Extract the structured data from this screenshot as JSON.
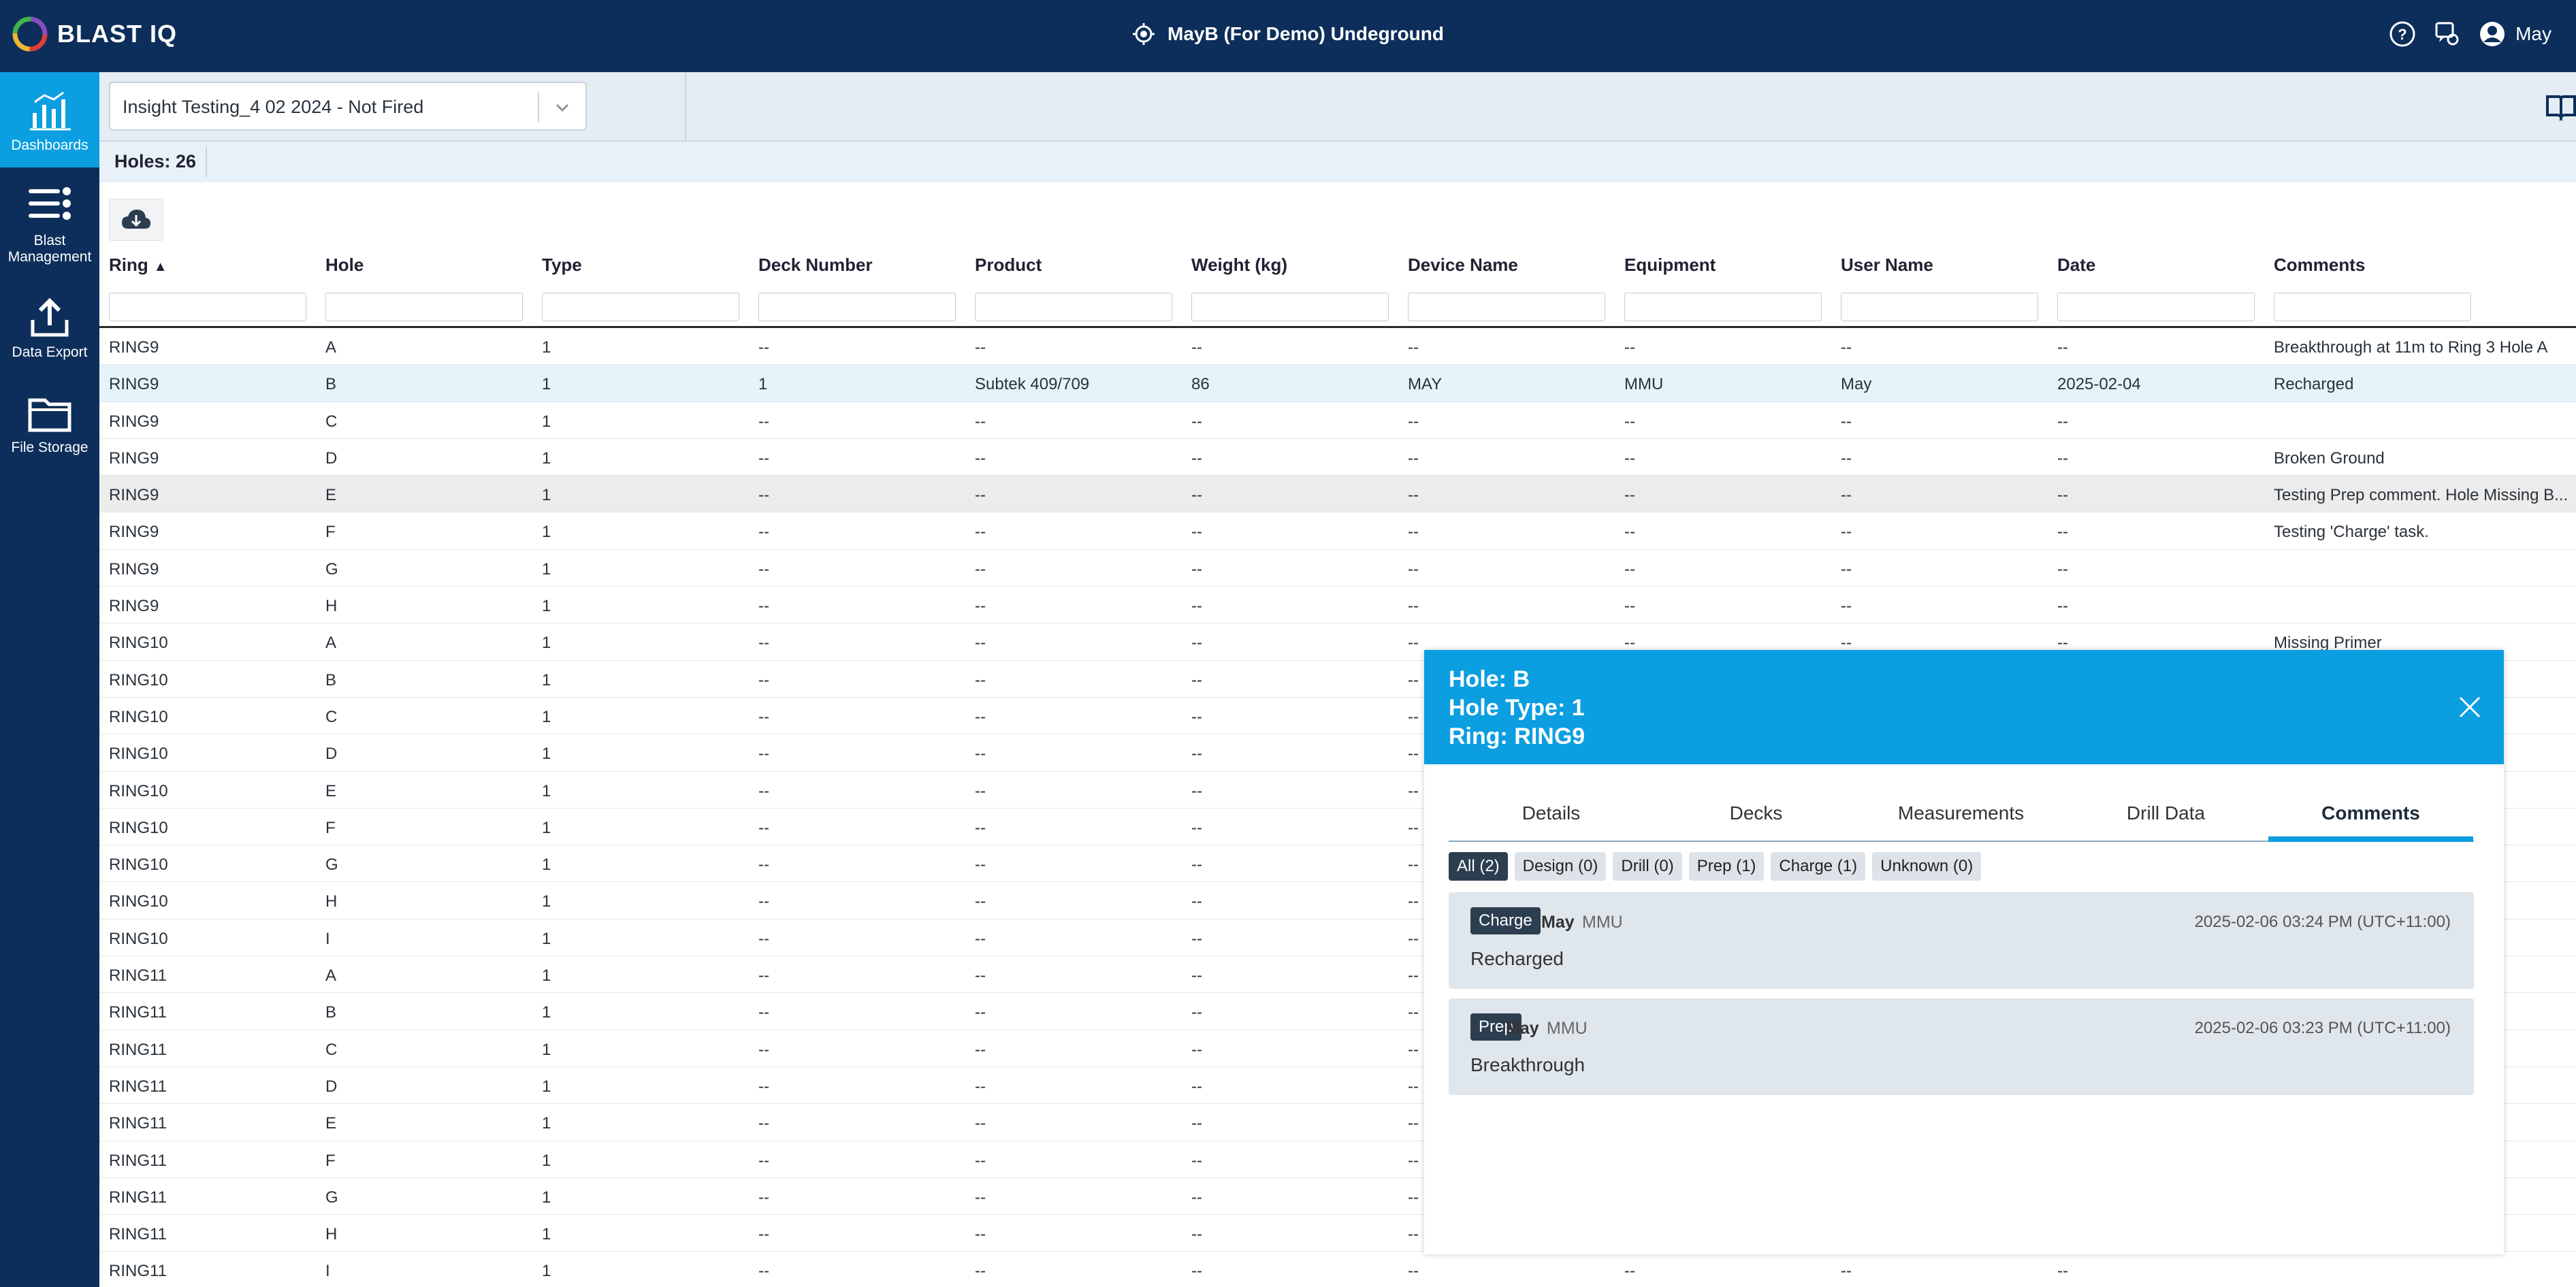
{
  "app": {
    "logo_text": "BLAST IQ",
    "site_name": "MayB (For Demo) Undeground",
    "user_name": "May"
  },
  "sidebar": {
    "items": [
      {
        "label": "Dashboards",
        "icon": "dashboards-icon",
        "active": true
      },
      {
        "label": "Blast Management",
        "icon": "blast-management-icon",
        "active": false
      },
      {
        "label": "Data Export",
        "icon": "data-export-icon",
        "active": false
      },
      {
        "label": "File Storage",
        "icon": "file-storage-icon",
        "active": false
      }
    ]
  },
  "toolbar": {
    "blast_select": "Insight Testing_4 02 2024 - Not Fired"
  },
  "summary": {
    "holes_count": "Holes: 26"
  },
  "table": {
    "columns": [
      "Ring",
      "Hole",
      "Type",
      "Deck Number",
      "Product",
      "Weight (kg)",
      "Device Name",
      "Equipment",
      "User Name",
      "Date",
      "Comments"
    ],
    "sort_indicator": "▲",
    "rows": [
      [
        "RING9",
        "A",
        "1",
        "--",
        "--",
        "--",
        "--",
        "--",
        "--",
        "--",
        "Breakthrough at 11m to Ring 3 Hole A"
      ],
      [
        "RING9",
        "B",
        "1",
        "1",
        "Subtek 409/709",
        "86",
        "MAY",
        "MMU",
        "May",
        "2025-02-04",
        "Recharged"
      ],
      [
        "RING9",
        "C",
        "1",
        "--",
        "--",
        "--",
        "--",
        "--",
        "--",
        "--",
        ""
      ],
      [
        "RING9",
        "D",
        "1",
        "--",
        "--",
        "--",
        "--",
        "--",
        "--",
        "--",
        "Broken Ground"
      ],
      [
        "RING9",
        "E",
        "1",
        "--",
        "--",
        "--",
        "--",
        "--",
        "--",
        "--",
        "Testing Prep comment. Hole Missing B..."
      ],
      [
        "RING9",
        "F",
        "1",
        "--",
        "--",
        "--",
        "--",
        "--",
        "--",
        "--",
        "Testing 'Charge' task."
      ],
      [
        "RING9",
        "G",
        "1",
        "--",
        "--",
        "--",
        "--",
        "--",
        "--",
        "--",
        ""
      ],
      [
        "RING9",
        "H",
        "1",
        "--",
        "--",
        "--",
        "--",
        "--",
        "--",
        "--",
        ""
      ],
      [
        "RING10",
        "A",
        "1",
        "--",
        "--",
        "--",
        "--",
        "--",
        "--",
        "--",
        "Missing Primer"
      ],
      [
        "RING10",
        "B",
        "1",
        "--",
        "--",
        "--",
        "--",
        "",
        "",
        "",
        ""
      ],
      [
        "RING10",
        "C",
        "1",
        "--",
        "--",
        "--",
        "--",
        "",
        "",
        "",
        ""
      ],
      [
        "RING10",
        "D",
        "1",
        "--",
        "--",
        "--",
        "--",
        "",
        "",
        "",
        ""
      ],
      [
        "RING10",
        "E",
        "1",
        "--",
        "--",
        "--",
        "--",
        "",
        "",
        "",
        ""
      ],
      [
        "RING10",
        "F",
        "1",
        "--",
        "--",
        "--",
        "--",
        "",
        "",
        "",
        ""
      ],
      [
        "RING10",
        "G",
        "1",
        "--",
        "--",
        "--",
        "--",
        "",
        "",
        "",
        ""
      ],
      [
        "RING10",
        "H",
        "1",
        "--",
        "--",
        "--",
        "--",
        "",
        "",
        "",
        ""
      ],
      [
        "RING10",
        "I",
        "1",
        "--",
        "--",
        "--",
        "--",
        "",
        "",
        "",
        ""
      ],
      [
        "RING11",
        "A",
        "1",
        "--",
        "--",
        "--",
        "--",
        "",
        "",
        "",
        ""
      ],
      [
        "RING11",
        "B",
        "1",
        "--",
        "--",
        "--",
        "--",
        "",
        "",
        "",
        ""
      ],
      [
        "RING11",
        "C",
        "1",
        "--",
        "--",
        "--",
        "--",
        "",
        "",
        "",
        ""
      ],
      [
        "RING11",
        "D",
        "1",
        "--",
        "--",
        "--",
        "--",
        "",
        "",
        "",
        ""
      ],
      [
        "RING11",
        "E",
        "1",
        "--",
        "--",
        "--",
        "--",
        "",
        "",
        "",
        ""
      ],
      [
        "RING11",
        "F",
        "1",
        "--",
        "--",
        "--",
        "--",
        "",
        "",
        "",
        ""
      ],
      [
        "RING11",
        "G",
        "1",
        "--",
        "--",
        "--",
        "--",
        "",
        "",
        "",
        ""
      ],
      [
        "RING11",
        "H",
        "1",
        "--",
        "--",
        "--",
        "--",
        "",
        "",
        "",
        ""
      ],
      [
        "RING11",
        "I",
        "1",
        "--",
        "--",
        "--",
        "--",
        "--",
        "--",
        "--",
        ""
      ]
    ]
  },
  "popup": {
    "hole": "Hole: B",
    "hole_type": "Hole Type: 1",
    "ring": "Ring: RING9",
    "tabs": [
      "Details",
      "Decks",
      "Measurements",
      "Drill Data",
      "Comments"
    ],
    "active_tab": "Comments",
    "filters": [
      "All (2)",
      "Design (0)",
      "Drill (0)",
      "Prep (1)",
      "Charge (1)",
      "Unknown (0)"
    ],
    "comments": [
      {
        "task": "Charge",
        "user": "May",
        "equipment": "MMU",
        "timestamp": "2025-02-06 03:24 PM (UTC+11:00)",
        "text": "Recharged"
      },
      {
        "task": "Prep",
        "user": "May",
        "equipment": "MMU",
        "timestamp": "2025-02-06 03:23 PM (UTC+11:00)",
        "text": "Breakthrough"
      }
    ]
  },
  "colors": {
    "nav_bg": "#0d2e5a",
    "accent": "#0b9ee0",
    "badge": "#2c3e50",
    "selected_row": "#e6f3fb"
  }
}
